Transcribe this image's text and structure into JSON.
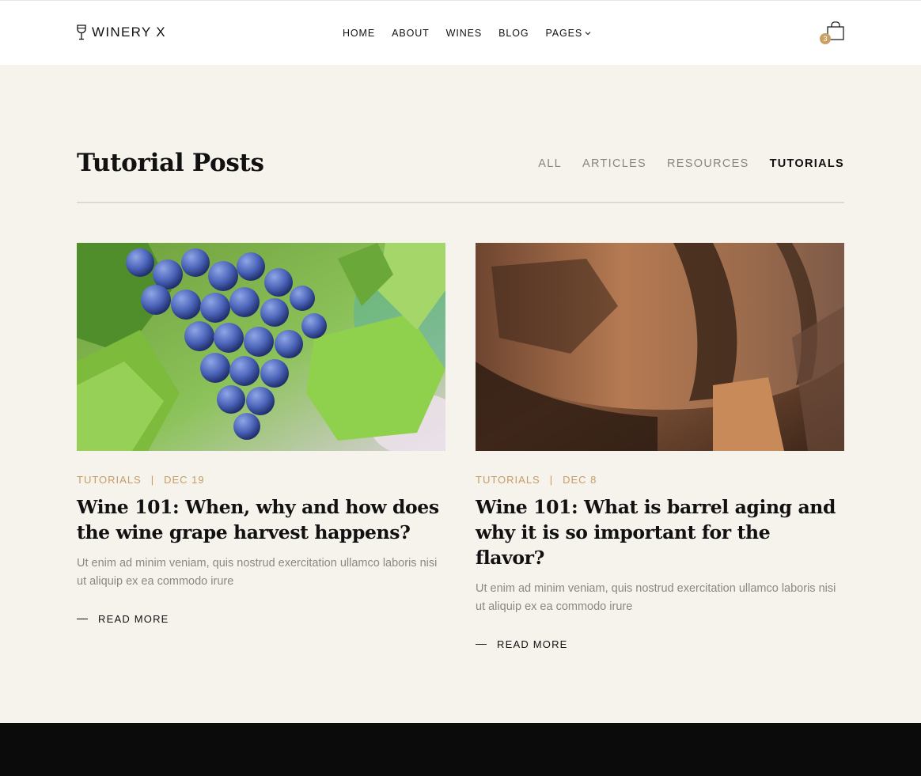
{
  "header": {
    "logo_text": "WINERY X",
    "nav": [
      "HOME",
      "ABOUT",
      "WINES",
      "BLOG",
      "PAGES"
    ],
    "cart_count": "3"
  },
  "section": {
    "title": "Tutorial Posts",
    "filters": [
      "ALL",
      "ARTICLES",
      "RESOURCES",
      "TUTORIALS"
    ],
    "active_filter": "TUTORIALS"
  },
  "posts": [
    {
      "category": "TUTORIALS",
      "date": "DEC 19",
      "title": "Wine 101: When, why and how does the wine grape harvest happens?",
      "excerpt": "Ut enim ad minim veniam, quis nostrud exercitation ullamco laboris nisi ut aliquip ex ea commodo irure",
      "read_more": "READ MORE"
    },
    {
      "category": "TUTORIALS",
      "date": "DEC 8",
      "title": "Wine 101: What is barrel aging and why it is so important for the flavor?",
      "excerpt": "Ut enim ad minim veniam, quis nostrud exercitation ullamco laboris nisi ut aliquip ex ea commodo irure",
      "read_more": "READ MORE"
    }
  ],
  "colors": {
    "background": "#f6f2ec",
    "accent": "#c9a165",
    "footer": "#0b0b0b"
  }
}
